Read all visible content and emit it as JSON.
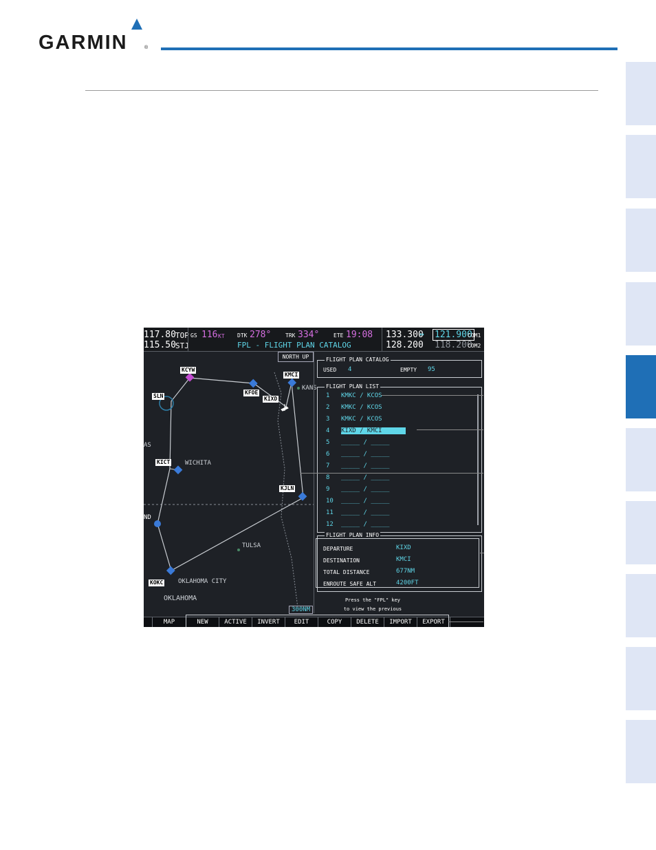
{
  "brand": {
    "name": "GARMIN",
    "reg": "®"
  },
  "colors": {
    "accent": "#1f6fb6",
    "tab": "#dfe6f5",
    "screen_bg": "#1e2126",
    "cyan": "#5fd6e8",
    "magenta": "#d56ee0"
  },
  "screen": {
    "topbar": {
      "nav1": "117.80",
      "nav1_id": "TOP",
      "nav2": "115.50",
      "nav2_id": "STJ",
      "gs_label": "GS",
      "gs": "116",
      "gs_unit": "KT",
      "dtk_label": "DTK",
      "dtk": "278°",
      "trk_label": "TRK",
      "trk": "334°",
      "ete_label": "ETE",
      "ete": "19:08",
      "title": "FPL - FLIGHT PLAN CATALOG",
      "com1_standby": "133.300",
      "swap": "↔",
      "com1_active": "121.900",
      "com1_label": "COM1",
      "com2_standby": "128.200",
      "com2_active": "118.200",
      "com2_label": "COM2"
    },
    "map": {
      "north_up": "NORTH UP",
      "scale": "300NM",
      "waypoints": [
        "KCYW",
        "SLN",
        "KFOE",
        "KIXD",
        "KMCI",
        "KICT",
        "KJLN",
        "KOKC",
        "ND"
      ],
      "labels": {
        "kans": "KANS",
        "as": "AS",
        "wichita": "WICHITA",
        "tulsa": "TULSA",
        "okc": "OKLAHOMA CITY",
        "oklahoma": "OKLAHOMA"
      }
    },
    "catalog": {
      "title": "FLIGHT PLAN CATALOG",
      "used_label": "USED",
      "used": "4",
      "empty_label": "EMPTY",
      "empty": "95"
    },
    "list": {
      "title": "FLIGHT PLAN LIST",
      "rows": [
        {
          "num": "1",
          "plan": "KMKC / KCOS"
        },
        {
          "num": "2",
          "plan": "KMKC / KCOS"
        },
        {
          "num": "3",
          "plan": "KMKC / KCOS"
        },
        {
          "num": "4",
          "plan": "KIXD / KMCI"
        },
        {
          "num": "5",
          "plan": "_____ / _____"
        },
        {
          "num": "6",
          "plan": "_____ / _____"
        },
        {
          "num": "7",
          "plan": "_____ / _____"
        },
        {
          "num": "8",
          "plan": "_____ / _____"
        },
        {
          "num": "9",
          "plan": "_____ / _____"
        },
        {
          "num": "10",
          "plan": "_____ / _____"
        },
        {
          "num": "11",
          "plan": "_____ / _____"
        },
        {
          "num": "12",
          "plan": "_____ / _____"
        }
      ]
    },
    "info": {
      "title": "FLIGHT PLAN INFO",
      "departure_label": "DEPARTURE",
      "departure": "KIXD",
      "destination_label": "DESTINATION",
      "destination": "KMCI",
      "distance_label": "TOTAL DISTANCE",
      "distance": "677NM",
      "alt_label": "ENROUTE SAFE ALT",
      "alt": "4200FT"
    },
    "message": "Press the \"FPL\" key to view the previous page",
    "softkeys": [
      "MAP",
      "NEW",
      "ACTIVE",
      "INVERT",
      "EDIT",
      "COPY",
      "DELETE",
      "IMPORT",
      "EXPORT"
    ]
  }
}
